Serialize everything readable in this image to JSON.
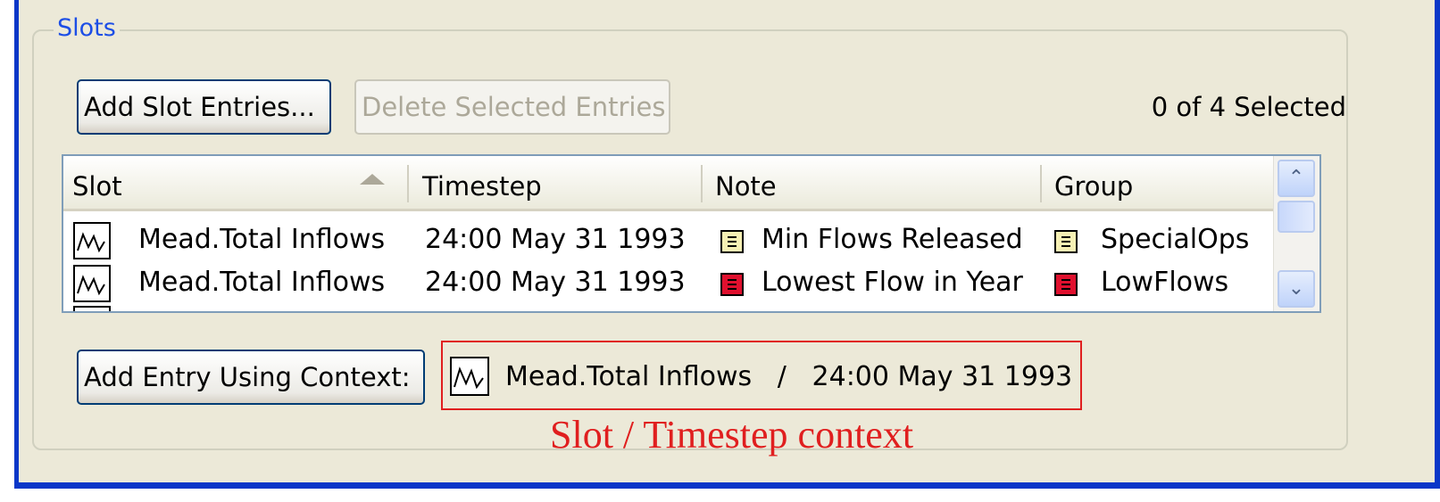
{
  "group": {
    "title": "Slots"
  },
  "toolbar": {
    "add_label": "Add Slot Entries...",
    "delete_label": "Delete Selected Entries",
    "selection_count": "0 of 4 Selected"
  },
  "table": {
    "columns": [
      "Slot",
      "Timestep",
      "Note",
      "Group"
    ],
    "sort_column": "Slot",
    "rows": [
      {
        "slot": "Mead.Total Inflows",
        "timestep": "24:00 May 31 1993",
        "note": "Min Flows Released",
        "note_color": "#f6f0b4",
        "group": "SpecialOps",
        "group_color": "#f6f0b4"
      },
      {
        "slot": "Mead.Total Inflows",
        "timestep": "24:00 May 31 1993",
        "note": "Lowest Flow in Year",
        "note_color": "#e0102e",
        "group": "LowFlows",
        "group_color": "#e0102e"
      }
    ]
  },
  "context": {
    "button_label": "Add Entry Using Context:",
    "slot": "Mead.Total Inflows",
    "separator": "/",
    "timestep": "24:00 May 31 1993"
  },
  "annotation": {
    "text": "Slot / Timestep context",
    "color": "#e01f1f"
  },
  "colors": {
    "title_blue": "#1c4ee6",
    "window_frame": "#0a37c8",
    "panel_bg": "#ece9d8"
  }
}
